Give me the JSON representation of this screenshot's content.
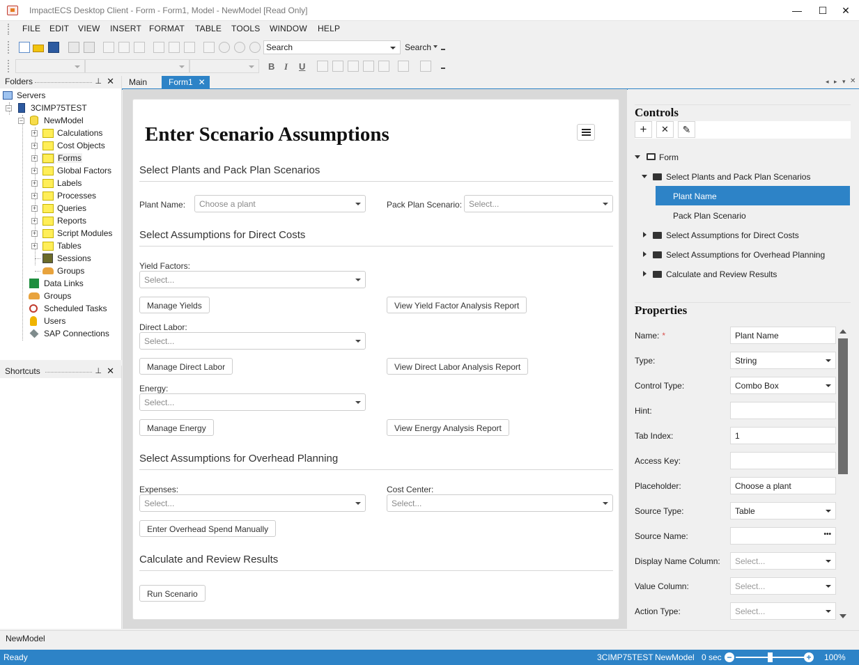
{
  "window": {
    "title": "ImpactECS Desktop Client - Form - Form1, Model - NewModel [Read Only]",
    "minimize": "—",
    "maximize": "☐",
    "close": "✕"
  },
  "menu": [
    "FILE",
    "EDIT",
    "VIEW",
    "INSERT",
    "FORMAT",
    "TABLE",
    "TOOLS",
    "WINDOW",
    "HELP"
  ],
  "toolbar": {
    "search_value": "Search",
    "search_button": "Search"
  },
  "format_toolbar": {
    "bold": "B",
    "italic": "I",
    "underline": "U"
  },
  "tabs": [
    {
      "label": "Main"
    },
    {
      "label": "Form1",
      "active": true,
      "close": "✕"
    }
  ],
  "folders": {
    "header": "Folders",
    "pin": "⊥",
    "close": "✕",
    "servers": "Servers",
    "server": "3CIMP75TEST",
    "model": "NewModel",
    "items": [
      "Calculations",
      "Cost Objects",
      "Forms",
      "Global Factors",
      "Labels",
      "Processes",
      "Queries",
      "Reports",
      "Script Modules",
      "Tables",
      "Sessions",
      "Groups"
    ],
    "server_items": [
      "Data Links",
      "Groups",
      "Scheduled Tasks",
      "Users",
      "SAP Connections"
    ]
  },
  "shortcuts": {
    "header": "Shortcuts"
  },
  "form": {
    "title": "Enter Scenario Assumptions",
    "sections": {
      "s1": "Select Plants and Pack Plan Scenarios",
      "s2": "Select Assumptions for Direct Costs",
      "s3": "Select Assumptions for Overhead Planning",
      "s4": "Calculate and Review Results"
    },
    "plant_label": "Plant Name:",
    "plant_placeholder": "Choose a plant",
    "pack_label": "Pack Plan Scenario:",
    "select_placeholder": "Select...",
    "yield_label": "Yield Factors:",
    "manage_yields": "Manage Yields",
    "view_yield": "View Yield Factor Analysis Report",
    "labor_label": "Direct Labor:",
    "manage_labor": "Manage Direct Labor",
    "view_labor": "View Direct Labor Analysis Report",
    "energy_label": "Energy:",
    "manage_energy": "Manage Energy",
    "view_energy": "View Energy Analysis Report",
    "expenses_label": "Expenses:",
    "cost_center_label": "Cost Center:",
    "overhead_button": "Enter Overhead Spend Manually",
    "run_button": "Run Scenario"
  },
  "controls": {
    "title": "Controls",
    "add": "+",
    "remove": "✕",
    "edit": "✎",
    "tree": {
      "form": "Form",
      "group1": "Select Plants and Pack Plan Scenarios",
      "plant_name": "Plant Name",
      "pack_plan": "Pack Plan Scenario",
      "group2": "Select Assumptions for Direct Costs",
      "group3": "Select Assumptions for Overhead Planning",
      "group4": "Calculate and Review Results"
    }
  },
  "properties": {
    "title": "Properties",
    "required_mark": "*",
    "rows": [
      {
        "label": "Name:",
        "value": "Plant Name"
      },
      {
        "label": "Type:",
        "value": "String"
      },
      {
        "label": "Control Type:",
        "value": "Combo Box"
      },
      {
        "label": "Hint:",
        "value": ""
      },
      {
        "label": "Tab Index:",
        "value": "1"
      },
      {
        "label": "Access Key:",
        "value": ""
      },
      {
        "label": "Placeholder:",
        "value": "Choose a plant"
      },
      {
        "label": "Source Type:",
        "value": "Table"
      },
      {
        "label": "Source Name:",
        "value": ""
      },
      {
        "label": "Display Name Column:",
        "value": "Select..."
      },
      {
        "label": "Value Column:",
        "value": "Select..."
      },
      {
        "label": "Action Type:",
        "value": "Select..."
      }
    ],
    "ellipsis": "•••"
  },
  "bottom_tab": "NewModel",
  "status": {
    "left": "Ready",
    "server": "3CIMP75TEST",
    "model": "NewModel",
    "time": "0 sec",
    "zoom": "100%",
    "zoom_level": 0.5
  }
}
